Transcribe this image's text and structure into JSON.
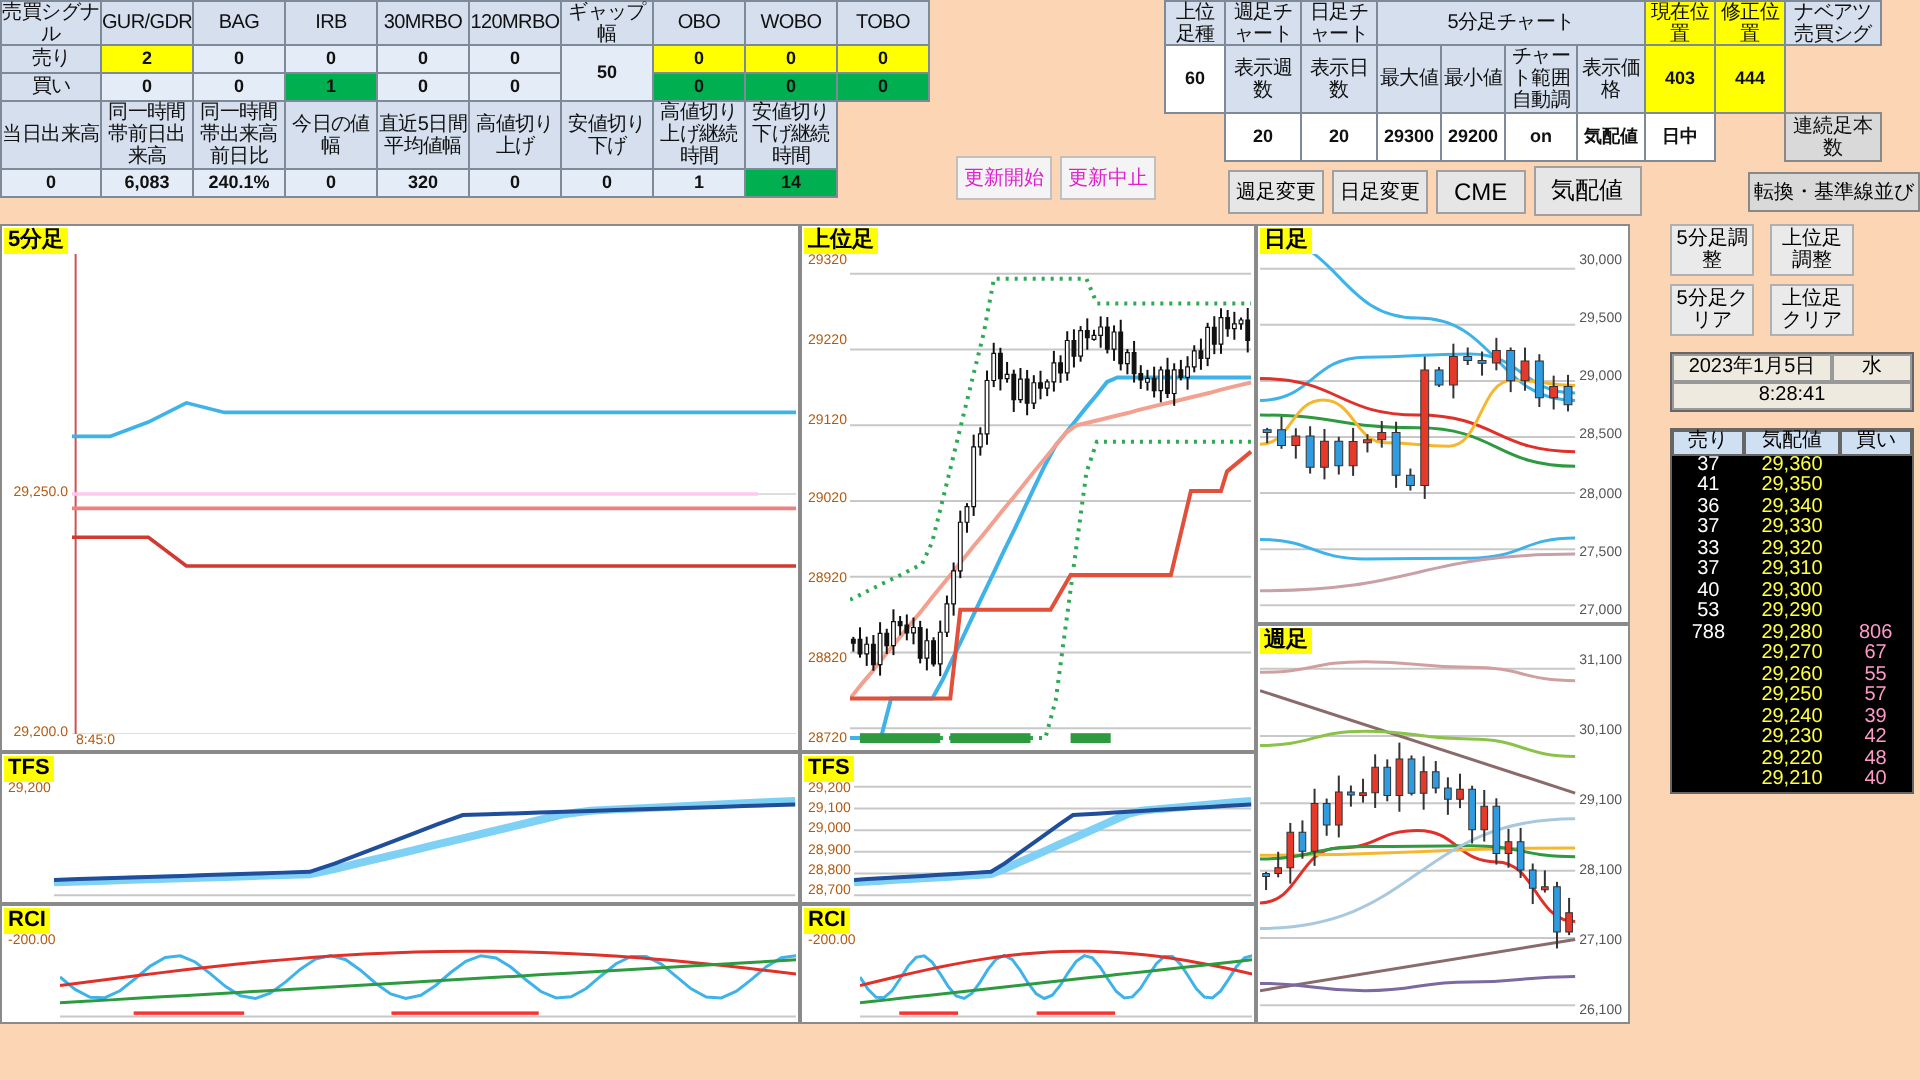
{
  "left_table": {
    "rows": [
      [
        {
          "kind": "label",
          "text": "売買シグナル"
        },
        {
          "kind": "label",
          "text": "GUR/GDR"
        },
        {
          "kind": "label",
          "text": "BAG"
        },
        {
          "kind": "label",
          "text": "IRB"
        },
        {
          "kind": "label",
          "text": "30MRBO"
        },
        {
          "kind": "label",
          "text": "120MRBO"
        },
        {
          "kind": "label",
          "text": "ギャップ幅"
        },
        {
          "kind": "label",
          "text": "OBO"
        },
        {
          "kind": "label",
          "text": "WOBO"
        },
        {
          "kind": "label",
          "text": "TOBO"
        }
      ],
      [
        {
          "kind": "label",
          "text": "売り"
        },
        {
          "kind": "value",
          "text": "2",
          "color": "#ffff00"
        },
        {
          "kind": "value",
          "text": "0"
        },
        {
          "kind": "value",
          "text": "0"
        },
        {
          "kind": "value",
          "text": "0"
        },
        {
          "kind": "value",
          "text": "0"
        },
        {
          "kind": "value",
          "text": "50",
          "rowspan": 2
        },
        {
          "kind": "value",
          "text": "0",
          "color": "#ffff00"
        },
        {
          "kind": "value",
          "text": "0",
          "color": "#ffff00"
        },
        {
          "kind": "value",
          "text": "0",
          "color": "#ffff00"
        }
      ],
      [
        {
          "kind": "label",
          "text": "買い"
        },
        {
          "kind": "value",
          "text": "0"
        },
        {
          "kind": "value",
          "text": "0"
        },
        {
          "kind": "value",
          "text": "1",
          "color": "#00b050"
        },
        {
          "kind": "value",
          "text": "0"
        },
        {
          "kind": "value",
          "text": "0"
        },
        {
          "kind": "value",
          "text": "0",
          "color": "#00b050"
        },
        {
          "kind": "value",
          "text": "0",
          "color": "#00b050"
        },
        {
          "kind": "value",
          "text": "0",
          "color": "#00b050"
        }
      ],
      [
        {
          "kind": "label",
          "text": "当日出来高"
        },
        {
          "kind": "label",
          "text": "同一時間帯前日出来高"
        },
        {
          "kind": "label",
          "text": "同一時間帯出来高前日比"
        },
        {
          "kind": "label",
          "text": "今日の値幅"
        },
        {
          "kind": "label",
          "text": "直近5日間平均値幅"
        },
        {
          "kind": "label",
          "text": "高値切り上げ"
        },
        {
          "kind": "label",
          "text": "安値切り下げ"
        },
        {
          "kind": "label",
          "text": "高値切り上げ継続時間"
        },
        {
          "kind": "label",
          "text": "安値切り下げ継続時間"
        }
      ],
      [
        {
          "kind": "value",
          "text": "0"
        },
        {
          "kind": "value",
          "text": "6,083"
        },
        {
          "kind": "value",
          "text": "240.1%"
        },
        {
          "kind": "value",
          "text": "0"
        },
        {
          "kind": "value",
          "text": "320"
        },
        {
          "kind": "value",
          "text": "0"
        },
        {
          "kind": "value",
          "text": "0"
        },
        {
          "kind": "value",
          "text": "1"
        },
        {
          "kind": "value",
          "text": "14",
          "color": "#00b050"
        }
      ]
    ]
  },
  "update_buttons": [
    "更新開始",
    "更新中止"
  ],
  "right_table": {
    "rows": [
      [
        {
          "kind": "label",
          "text": "上位足種"
        },
        {
          "kind": "label",
          "text": "週足チャート"
        },
        {
          "kind": "label",
          "text": "日足チャート"
        },
        {
          "kind": "label",
          "text": "5分足チャート",
          "colspan": 4
        },
        {
          "kind": "label",
          "text": "現在位置",
          "color": "#ffff00"
        },
        {
          "kind": "label",
          "text": "修正位置",
          "color": "#ffff00"
        },
        {
          "kind": "label",
          "text": "ナベアツ売買シグ"
        }
      ],
      [
        {
          "kind": "value",
          "text": "60"
        },
        {
          "kind": "label",
          "text": "表示週数"
        },
        {
          "kind": "label",
          "text": "表示日数"
        },
        {
          "kind": "label",
          "text": "最大値"
        },
        {
          "kind": "label",
          "text": "最小値"
        },
        {
          "kind": "label",
          "text": "チャート範囲自動調"
        },
        {
          "kind": "label",
          "text": "表示価格"
        },
        {
          "kind": "value",
          "text": "403",
          "color": "#ffff00"
        },
        {
          "kind": "value",
          "text": "444",
          "color": "#ffff00"
        },
        {
          "kind": "blank"
        }
      ],
      [
        {
          "kind": "blank"
        },
        {
          "kind": "value",
          "text": "20"
        },
        {
          "kind": "value",
          "text": "20"
        },
        {
          "kind": "value",
          "text": "29300"
        },
        {
          "kind": "value",
          "text": "29200"
        },
        {
          "kind": "value",
          "text": "on"
        },
        {
          "kind": "value",
          "text": "気配値"
        },
        {
          "kind": "value",
          "text": "日中"
        },
        {
          "kind": "blank"
        },
        {
          "kind": "button",
          "text": "連続足本数"
        }
      ]
    ]
  },
  "chart_buttons": [
    "週足変更",
    "日足変更",
    "CME",
    "気配値"
  ],
  "side_button": "転換・基準線並び",
  "chart_columns": [
    {
      "panels": [
        {
          "kind": "intraday",
          "title": "5分足",
          "x_labels": [
            "8:45:0"
          ],
          "chart_data": {
            "type": "line",
            "ylim": [
              29200,
              29300
            ],
            "yticks": [
              {
                "value": 29250,
                "label": "29,250.0"
              },
              {
                "value": 29200,
                "label": "29,200.0"
              }
            ],
            "series": [
              {
                "color": "#3fb3e8",
                "values": [
                  29262,
                  29262,
                  29265,
                  29269,
                  29267,
                  29267,
                  29267,
                  29267,
                  29267,
                  29267,
                  29267,
                  29267,
                  29267,
                  29267,
                  29267,
                  29267,
                  29267,
                  29267,
                  29267,
                  29267
                ]
              },
              {
                "color": "#ffc8ec",
                "values": [
                  29250,
                  29250,
                  29250,
                  29250,
                  29250,
                  29250,
                  29250,
                  29250,
                  29250,
                  29250,
                  29250,
                  29250,
                  29250,
                  29250,
                  29250,
                  29250,
                  29250,
                  29250,
                  29250,
                  null
                ]
              },
              {
                "color": "#f08080",
                "values": [
                  29247,
                  29247,
                  29247,
                  29247,
                  29247,
                  29247,
                  29247,
                  29247,
                  29247,
                  29247,
                  29247,
                  29247,
                  29247,
                  29247,
                  29247,
                  29247,
                  29247,
                  29247,
                  29247,
                  29247
                ]
              },
              {
                "color": "#d03a30",
                "values": [
                  29241,
                  29241,
                  29241,
                  29235,
                  29235,
                  29235,
                  29235,
                  29235,
                  29235,
                  29235,
                  29235,
                  29235,
                  29235,
                  29235,
                  29235,
                  29235,
                  29235,
                  29235,
                  29235,
                  29235
                ]
              }
            ]
          }
        },
        {
          "kind": "tfs",
          "title": "TFS",
          "y_labels": [
            "29,200"
          ]
        },
        {
          "kind": "rci",
          "title": "RCI",
          "y_labels": [
            "-200.00"
          ]
        }
      ]
    },
    {
      "panels": [
        {
          "kind": "upper",
          "title": "上位足",
          "y_labels": [
            "29320",
            "29220",
            "29120",
            "29020",
            "28920",
            "28820",
            "28720"
          ]
        },
        {
          "kind": "tfs",
          "title": "TFS",
          "y_labels": [
            "29,200",
            "29,100",
            "29,000",
            "28,900",
            "28,800",
            "28,700"
          ]
        },
        {
          "kind": "rci",
          "title": "RCI",
          "y_labels": [
            "-200.00"
          ]
        }
      ]
    },
    {
      "panels": [
        {
          "kind": "daily",
          "title": "日足",
          "y_labels": [
            "30,000",
            "29,500",
            "29,000",
            "28,500",
            "28,000",
            "27,500",
            "27,000"
          ]
        },
        {
          "kind": "weekly",
          "title": "週足",
          "y_labels": [
            "31,100",
            "30,100",
            "29,100",
            "28,100",
            "27,100",
            "26,100"
          ]
        }
      ]
    }
  ],
  "adjust_buttons": [
    "5分足調整",
    "上位足調整",
    "5分足クリア",
    "上位足クリア"
  ],
  "clock": {
    "date": "2023年1月5日",
    "weekday": "水",
    "time": "8:28:41"
  },
  "order_book": {
    "columns": [
      "売り",
      "気配値",
      "買い"
    ],
    "rows": [
      {
        "sell": "37",
        "price": "29,360"
      },
      {
        "sell": "41",
        "price": "29,350"
      },
      {
        "sell": "36",
        "price": "29,340"
      },
      {
        "sell": "37",
        "price": "29,330"
      },
      {
        "sell": "33",
        "price": "29,320"
      },
      {
        "sell": "37",
        "price": "29,310"
      },
      {
        "sell": "40",
        "price": "29,300"
      },
      {
        "sell": "53",
        "price": "29,290"
      },
      {
        "sell": "788",
        "price": "29,280",
        "buy": "806"
      },
      {
        "price": "29,270",
        "buy": "67"
      },
      {
        "price": "29,260",
        "buy": "55"
      },
      {
        "price": "29,250",
        "buy": "57"
      },
      {
        "price": "29,240",
        "buy": "39"
      },
      {
        "price": "29,230",
        "buy": "42"
      },
      {
        "price": "29,220",
        "buy": "48"
      },
      {
        "price": "29,210",
        "buy": "40"
      }
    ]
  }
}
